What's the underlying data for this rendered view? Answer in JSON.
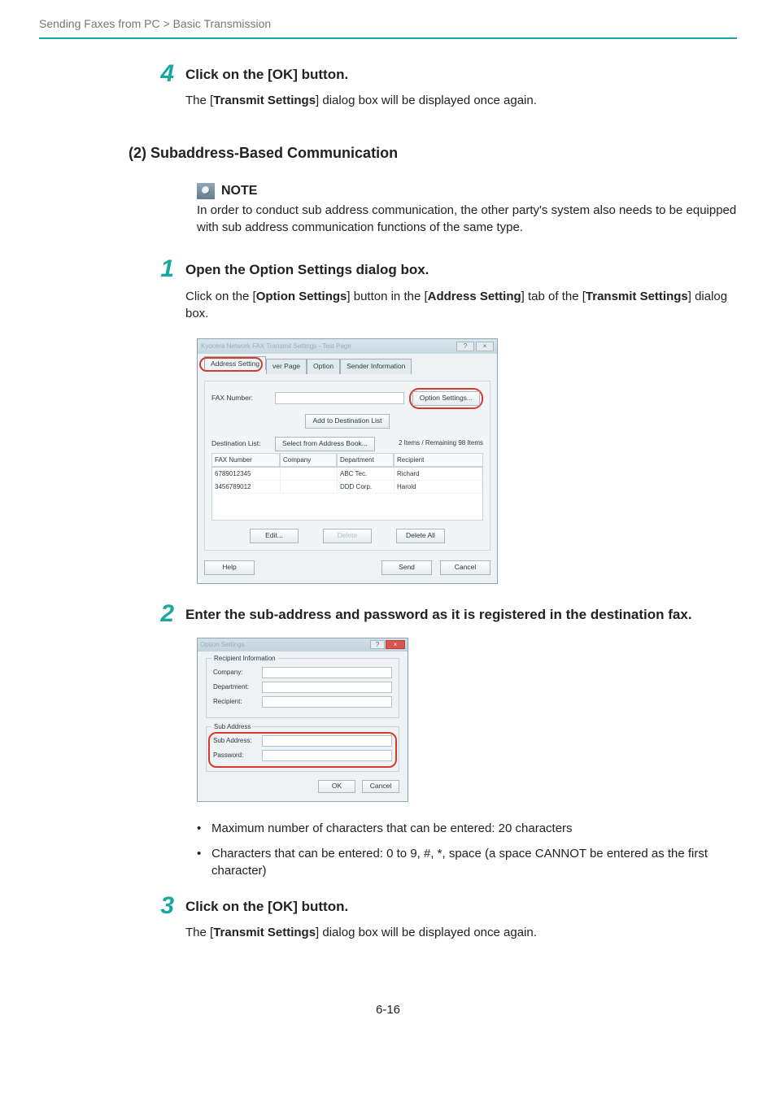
{
  "breadcrumb": "Sending Faxes from PC > Basic Transmission",
  "s4": {
    "num": "4",
    "title": "Click on the [OK] button.",
    "text_before": "The [",
    "text_bold": "Transmit Settings",
    "text_after": "] dialog box will be displayed once again."
  },
  "h2": "(2) Subaddress-Based Communication",
  "note": {
    "label": "NOTE",
    "text": "In order to conduct sub address communication, the other party's system also needs to be equipped with sub address communication functions of the same type."
  },
  "s1": {
    "num": "1",
    "title": "Open the Option Settings dialog box.",
    "p_a": "Click on the [",
    "p_b": "Option Settings",
    "p_c": "] button in the [",
    "p_d": "Address Setting",
    "p_e": "] tab of the [",
    "p_f": "Transmit Settings",
    "p_g": "] dialog box."
  },
  "dialog1": {
    "title": "Kyocera Network FAX   Transmit Settings - Test Page",
    "win_help": "?",
    "win_close": "×",
    "tabs": {
      "address": "Address Setting",
      "cover": "ver Page",
      "option": "Option",
      "sender": "Sender Information"
    },
    "fax_label": "FAX Number:",
    "option_btn": "Option Settings...",
    "add_btn": "Add to Destination List",
    "dest_label": "Destination List:",
    "select_btn": "Select from Address Book...",
    "status": "2 Items / Remaining 98 Items",
    "cols": {
      "fax": "FAX Number",
      "company": "Company",
      "dept": "Department",
      "recip": "Recipient"
    },
    "rows": [
      {
        "fax": "6789012345",
        "company": "",
        "dept": "ABC Tec.",
        "recip": "Richard"
      },
      {
        "fax": "3456789012",
        "company": "",
        "dept": "DDD Corp.",
        "recip": "Harold"
      }
    ],
    "edit": "Edit...",
    "delete": "Delete",
    "delete_all": "Delete All",
    "help": "Help",
    "send": "Send",
    "cancel": "Cancel"
  },
  "s2": {
    "num": "2",
    "title": "Enter the sub-address and password as it is registered in the destination fax."
  },
  "dialog2": {
    "title": "Option Settings",
    "close": "×",
    "group1": "Recipient Information",
    "company": "Company:",
    "dept": "Department:",
    "recip": "Recipient:",
    "group2": "Sub Address",
    "subaddr": "Sub Address:",
    "password": "Password:",
    "ok": "OK",
    "cancel": "Cancel"
  },
  "bullets": {
    "b1": "Maximum number of characters that can be entered: 20 characters",
    "b2": "Characters that can be entered: 0 to 9, #, *, space (a space CANNOT be entered as the first character)"
  },
  "s3": {
    "num": "3",
    "title": "Click on the [OK] button.",
    "text_before": "The [",
    "text_bold": "Transmit Settings",
    "text_after": "] dialog box will be displayed once again."
  },
  "page_number": "6-16"
}
